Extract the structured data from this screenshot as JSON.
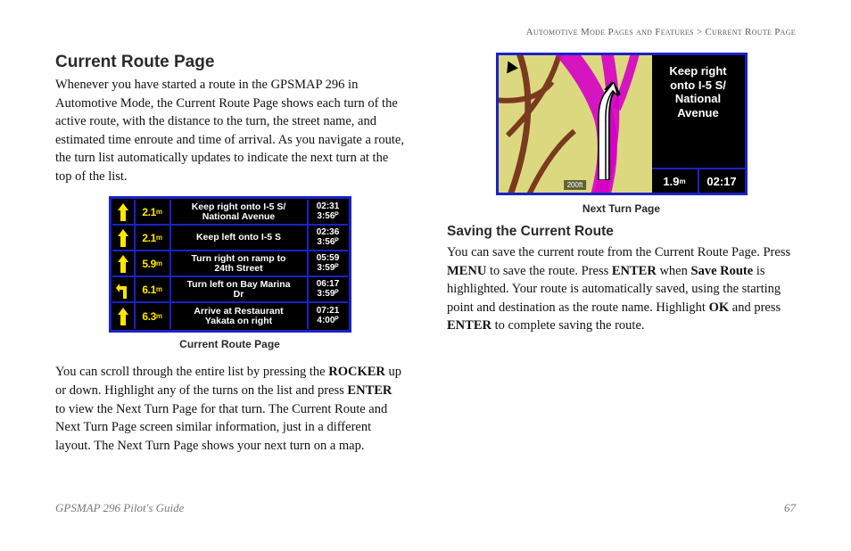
{
  "breadcrumb": "Automotive Mode Pages and Features > Current Route Page",
  "left": {
    "heading": "Current Route Page",
    "para1": "Whenever you have started a route in the GPSMAP 296 in Automotive Mode, the Current Route Page shows each turn of the active route, with the distance to the turn, the street name, and estimated time enroute and time of arrival. As you navigate a route, the turn list automatically updates to indicate the next turn at the top of the list.",
    "figure1_caption": "Current Route Page",
    "para2_before_rocker": "You can scroll through the entire list by pressing the ",
    "rocker": "ROCKER",
    "para2_mid": " up or down. Highlight any of the turns on the list and press ",
    "enter": "ENTER",
    "para2_after": " to view the Next Turn Page for that turn. The Current Route and Next Turn Page screen similar information, just in a different layout. The Next Turn Page shows your next turn on a map.",
    "routes": [
      {
        "dist": "2.1",
        "unit": "m",
        "name": "Keep right onto I-5 S/\nNational Avenue",
        "t1": "02:31",
        "t2": "3:56ᴾ",
        "dir": "up"
      },
      {
        "dist": "2.1",
        "unit": "m",
        "name": "Keep left onto I-5 S",
        "t1": "02:36",
        "t2": "3:56ᴾ",
        "dir": "up"
      },
      {
        "dist": "5.9",
        "unit": "m",
        "name": "Turn right on ramp to\n24th Street",
        "t1": "05:59",
        "t2": "3:59ᴾ",
        "dir": "up"
      },
      {
        "dist": "6.1",
        "unit": "m",
        "name": "Turn left on Bay Marina\nDr",
        "t1": "06:17",
        "t2": "3:59ᴾ",
        "dir": "left"
      },
      {
        "dist": "6.3",
        "unit": "m",
        "name": "Arrive at Restaurant\nYakata on right",
        "t1": "07:21",
        "t2": "4:00ᴾ",
        "dir": "up"
      }
    ]
  },
  "right": {
    "figure2_caption": "Next Turn Page",
    "map_message": "Keep right onto I-5 S/ National Avenue",
    "map_dist": "1.9",
    "map_dist_unit": "m",
    "map_time": "02:17",
    "map_scale": "200ft",
    "heading": "Saving the Current Route",
    "p_before_menu": "You can save the current route from the Current Route Page. Press ",
    "menu": "MENU",
    "p_mid1": " to save the route. Press ",
    "enter": "ENTER",
    "p_mid2": " when ",
    "save_route": "Save Route",
    "p_mid3": " is highlighted. Your route is automatically saved, using the starting point and destination as the route name. Highlight ",
    "ok": "OK",
    "p_mid4": " and press ",
    "enter2": "ENTER",
    "p_end": " to complete saving the route."
  },
  "footer": {
    "guide": "GPSMAP 296 Pilot's Guide",
    "page": "67"
  }
}
